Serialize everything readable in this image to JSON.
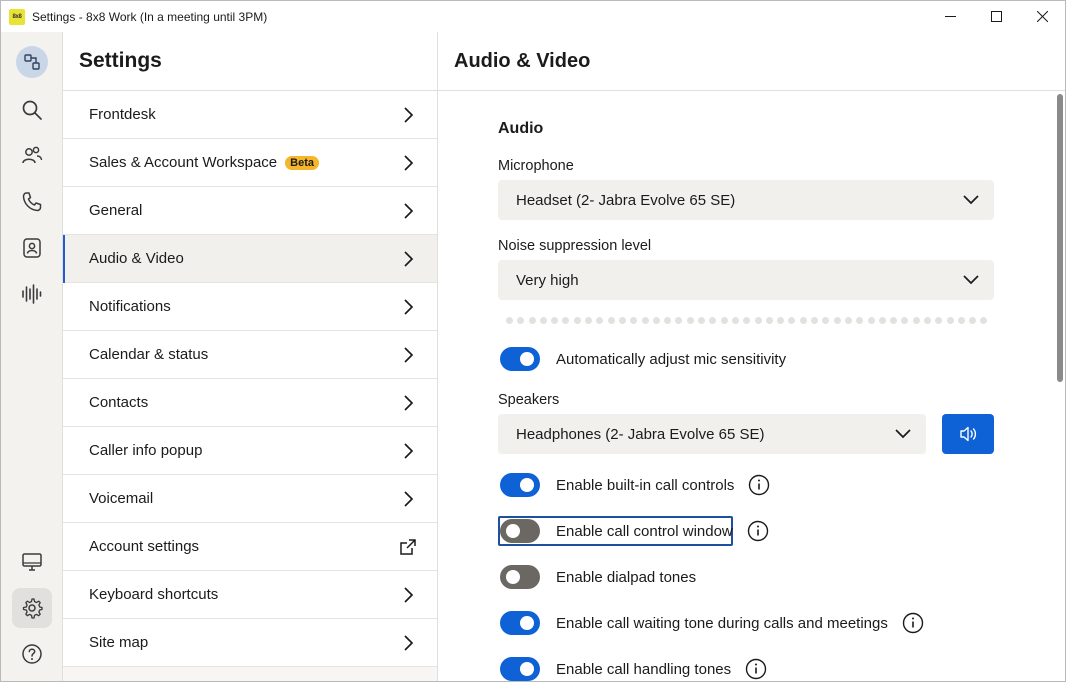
{
  "window": {
    "logo_text": "8x8",
    "title": "Settings - 8x8 Work (In a meeting until 3PM)"
  },
  "rail": {
    "items": [
      {
        "name": "presence-avatar"
      },
      {
        "name": "search"
      },
      {
        "name": "contacts"
      },
      {
        "name": "calls"
      },
      {
        "name": "directory"
      },
      {
        "name": "voicemail-audio"
      },
      {
        "name": "desktop"
      },
      {
        "name": "settings"
      },
      {
        "name": "help"
      }
    ]
  },
  "settings": {
    "title": "Settings",
    "items": [
      {
        "label": "Frontdesk",
        "icon": "chevron-right"
      },
      {
        "label": "Sales & Account Workspace",
        "badge": "Beta",
        "icon": "chevron-right"
      },
      {
        "label": "General",
        "icon": "chevron-right"
      },
      {
        "label": "Audio & Video",
        "icon": "chevron-right",
        "selected": true
      },
      {
        "label": "Notifications",
        "icon": "chevron-right"
      },
      {
        "label": "Calendar & status",
        "icon": "chevron-right"
      },
      {
        "label": "Contacts",
        "icon": "chevron-right"
      },
      {
        "label": "Caller info popup",
        "icon": "chevron-right"
      },
      {
        "label": "Voicemail",
        "icon": "chevron-right"
      },
      {
        "label": "Account settings",
        "icon": "external-link"
      },
      {
        "label": "Keyboard shortcuts",
        "icon": "chevron-right"
      },
      {
        "label": "Site map",
        "icon": "chevron-right"
      }
    ]
  },
  "content": {
    "title": "Audio & Video",
    "audio_section": "Audio",
    "microphone_label": "Microphone",
    "microphone_value": "Headset (2- Jabra Evolve 65 SE)",
    "noise_label": "Noise suppression level",
    "noise_value": "Very high",
    "auto_adjust_label": "Automatically adjust mic sensitivity",
    "speakers_label": "Speakers",
    "speakers_value": "Headphones (2- Jabra Evolve 65 SE)",
    "toggles": [
      {
        "label": "Enable built-in call controls",
        "on": true,
        "info": true
      },
      {
        "label": "Enable call control window",
        "on": false,
        "info": true,
        "focused": true
      },
      {
        "label": "Enable dialpad tones",
        "on": false,
        "info": false
      },
      {
        "label": "Enable call waiting tone during calls and meetings",
        "on": true,
        "info": true
      },
      {
        "label": "Enable call handling tones",
        "on": true,
        "info": true
      }
    ]
  },
  "colors": {
    "accent": "#0f62d6",
    "beta_badge": "#f5b62a",
    "toggle_off": "#6b6864"
  }
}
